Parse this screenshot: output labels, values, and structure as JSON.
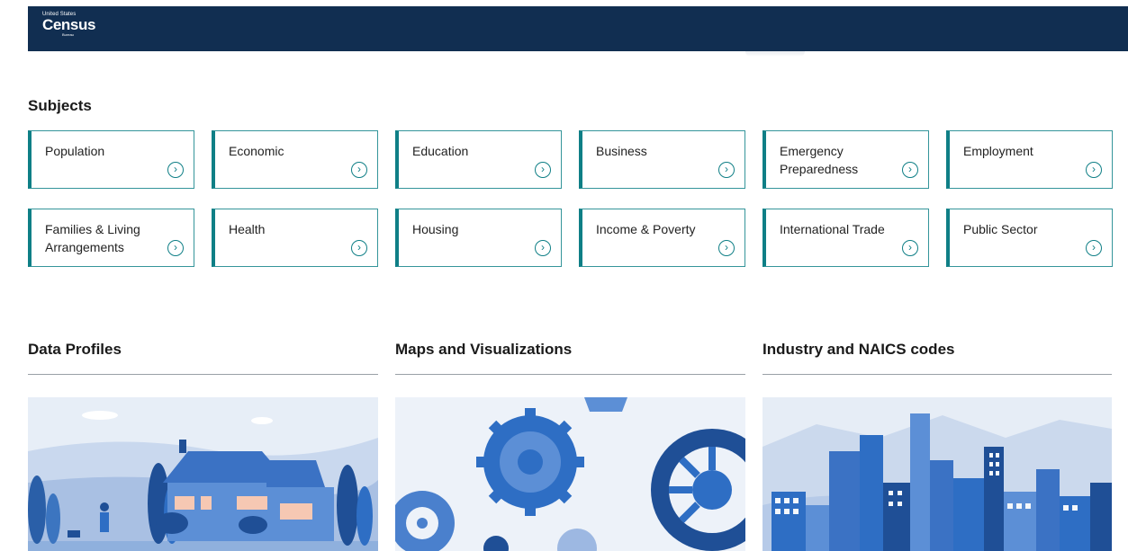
{
  "header": {
    "logo_top": "United States",
    "logo_main": "Census",
    "logo_sub": "Bureau"
  },
  "subjects": {
    "title": "Subjects",
    "items": [
      {
        "label": "Population"
      },
      {
        "label": "Economic"
      },
      {
        "label": "Education"
      },
      {
        "label": "Business"
      },
      {
        "label": "Emergency Preparedness"
      },
      {
        "label": "Employment"
      },
      {
        "label": "Families & Living Arrangements"
      },
      {
        "label": "Health"
      },
      {
        "label": "Housing"
      },
      {
        "label": "Income & Poverty"
      },
      {
        "label": "International Trade"
      },
      {
        "label": "Public Sector"
      }
    ],
    "arrow_icon": "chevron-right-circle-icon"
  },
  "features": [
    {
      "title": "Data Profiles",
      "image": "house-illustration"
    },
    {
      "title": "Maps and Visualizations",
      "image": "gears-illustration"
    },
    {
      "title": "Industry and NAICS codes",
      "image": "city-skyline-illustration"
    }
  ],
  "colors": {
    "header_bg": "#112e51",
    "card_accent": "#0f7f86",
    "illustration_blue": "#2e6ec4"
  }
}
